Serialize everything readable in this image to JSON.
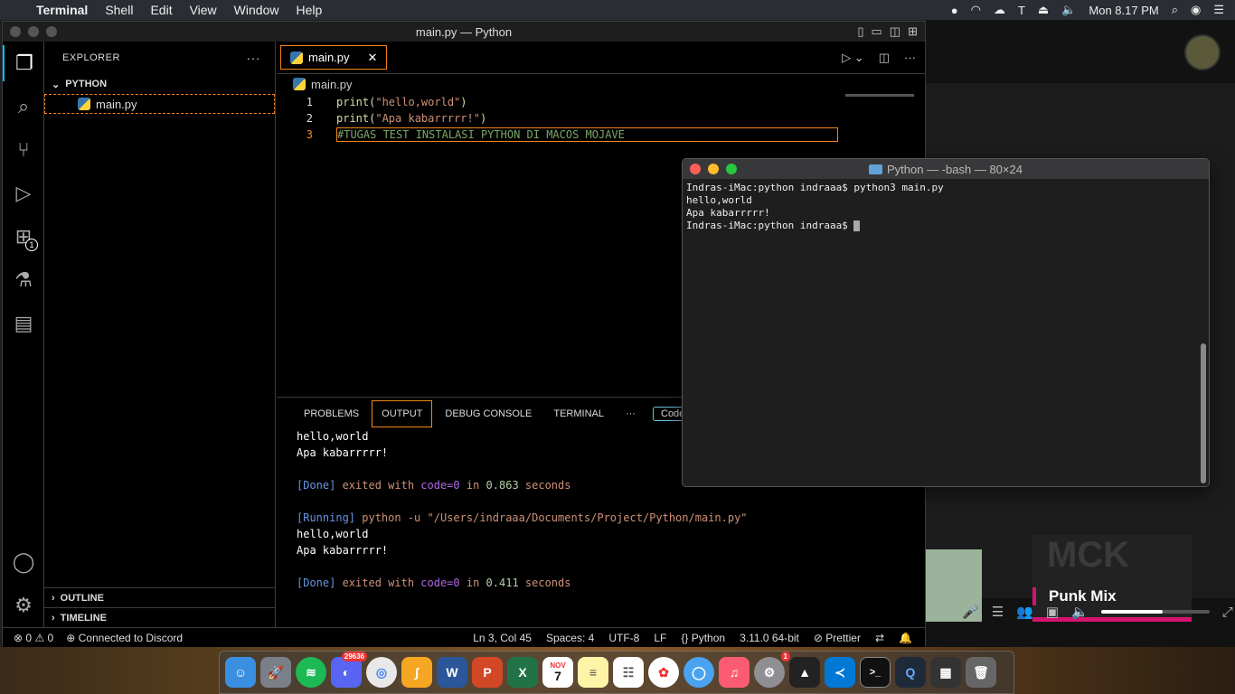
{
  "menubar": {
    "app_name": "Terminal",
    "items": [
      "Shell",
      "Edit",
      "View",
      "Window",
      "Help"
    ],
    "clock": "Mon 8.17 PM"
  },
  "vscode": {
    "window_title": "main.py — Python",
    "explorer_title": "EXPLORER",
    "folder_name": "PYTHON",
    "file_name": "main.py",
    "outline_label": "OUTLINE",
    "timeline_label": "TIMELINE",
    "extensions_badge": "1",
    "tab_label": "main.py",
    "breadcrumb": "main.py",
    "code": {
      "line1_num": "1",
      "line1_fn": "print(",
      "line1_str": "\"hello,world\"",
      "line1_end": ")",
      "line2_num": "2",
      "line2_fn": "print(",
      "line2_str": "\"Apa kabarrrrr!\"",
      "line2_end": ")",
      "line3_num": "3",
      "line3_txt": "#TUGAS TEST INSTALASI PYTHON DI MACOS MOJAVE"
    },
    "panel_tabs": {
      "problems": "PROBLEMS",
      "output": "OUTPUT",
      "debug": "DEBUG CONSOLE",
      "terminal": "TERMINAL",
      "more": "···",
      "code_button": "Code"
    },
    "output": {
      "l1": "hello,world",
      "l2": "Apa kabarrrrr!",
      "l4_tag": "[Done]",
      "l4_a": " exited with ",
      "l4_code": "code=0",
      "l4_b": " in ",
      "l4_time": "0.863",
      "l4_c": " seconds",
      "l6_tag": "[Running]",
      "l6_cmd": " python -u ",
      "l6_path": "\"/Users/indraaa/Documents/Project/Python/main.py\"",
      "l7": "hello,world",
      "l8": "Apa kabarrrrr!",
      "l10_tag": "[Done]",
      "l10_a": " exited with ",
      "l10_code": "code=0",
      "l10_b": " in ",
      "l10_time": "0.411",
      "l10_c": " seconds"
    },
    "status": {
      "errors": "0",
      "warnings": "0",
      "discord": "Connected to Discord",
      "position": "Ln 3, Col 45",
      "spaces": "Spaces: 4",
      "encoding": "UTF-8",
      "eol": "LF",
      "language": "Python",
      "version": "3.11.0 64-bit",
      "prettier": "Prettier"
    }
  },
  "terminal": {
    "title": "Python — -bash — 80×24",
    "line1": "Indras-iMac:python indraaa$ python3 main.py",
    "line2": "hello,world",
    "line3": "Apa kabarrrrr!",
    "line4": "Indras-iMac:python indraaa$ "
  },
  "spotify": {
    "mix_label": "Punk Mix",
    "mix_bg_text": "MCK",
    "volume_fraction": 0.57
  },
  "dock": {
    "discord_badge": "29636",
    "calendar_month": "NOV",
    "calendar_day": "7",
    "settings_badge": "1"
  },
  "colors": {
    "focus_outline": "#f38518",
    "activity_accent": "#00bfff",
    "spotify_pink": "#d5136f"
  }
}
